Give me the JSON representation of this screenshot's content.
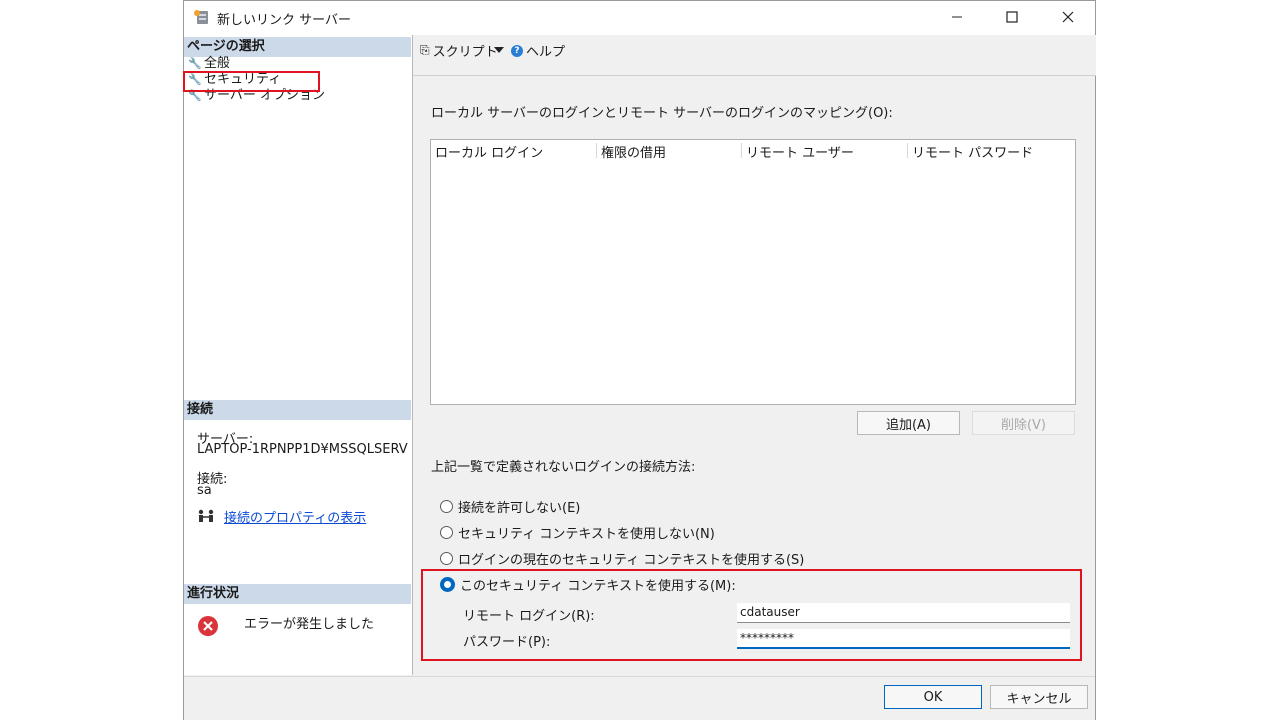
{
  "window": {
    "title": "新しいリンク サーバー"
  },
  "left_pane": {
    "page_select_header": "ページの選択",
    "pages": [
      {
        "label": "全般"
      },
      {
        "label": "セキュリティ"
      },
      {
        "label": "サーバー オプション"
      }
    ],
    "connection_header": "接続",
    "server_label": "サーバー:",
    "server_value": "LAPTOP-1RPNPP1D¥MSSQLSERV",
    "connection_label": "接続:",
    "connection_value": "sa",
    "view_props_link": "接続のプロパティの表示",
    "progress_header": "進行状況",
    "progress_status": "エラーが発生しました"
  },
  "toolbar": {
    "script_label": "スクリプト",
    "help_label": "ヘルプ"
  },
  "main": {
    "mapping_label": "ローカル サーバーのログインとリモート サーバーのログインのマッピング(O):",
    "grid_columns": [
      "ローカル ログイン",
      "権限の借用",
      "リモート ユーザー",
      "リモート パスワード"
    ],
    "add_button": "追加(A)",
    "delete_button": "削除(V)",
    "undefined_login_label": "上記一覧で定義されないログインの接続方法:",
    "radio_options": [
      "接続を許可しない(E)",
      "セキュリティ コンテキストを使用しない(N)",
      "ログインの現在のセキュリティ コンテキストを使用する(S)",
      "このセキュリティ コンテキストを使用する(M):"
    ],
    "selected_option_index": 3,
    "remote_login_label": "リモート ログイン(R):",
    "remote_login_value": "cdatauser",
    "password_label": "パスワード(P):",
    "password_value": "*********"
  },
  "footer": {
    "ok_button": "OK",
    "cancel_button": "キャンセル"
  },
  "colors": {
    "accent": "#0067c0",
    "highlight": "#e0141e",
    "section_header": "#ccd9e8",
    "link": "#0b4bd6",
    "error": "#d9343a"
  }
}
